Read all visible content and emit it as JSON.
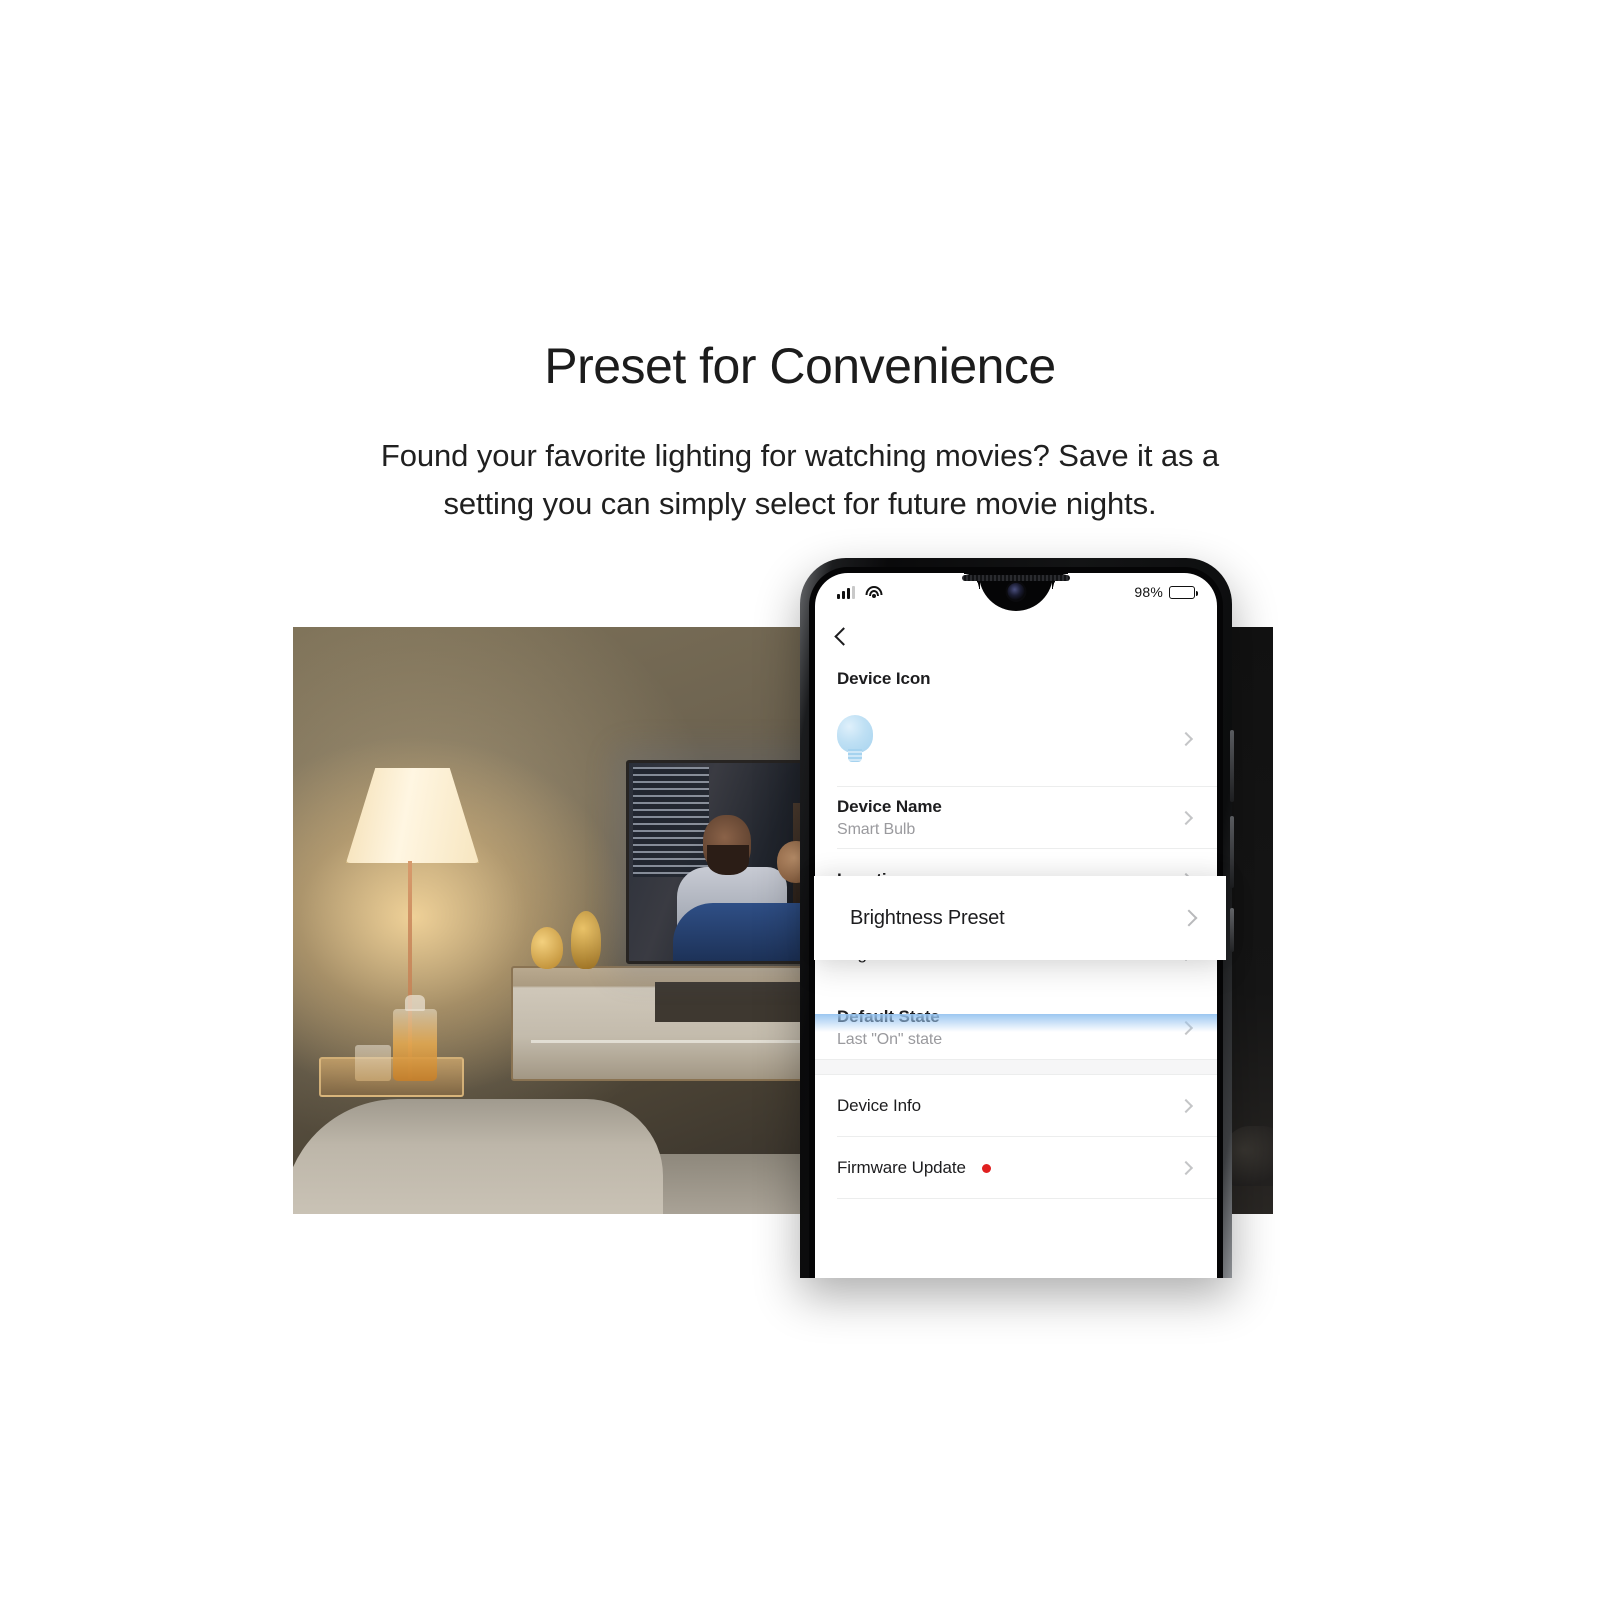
{
  "hero": {
    "title": "Preset for Convenience",
    "subtitle": "Found your favorite lighting for watching movies? Save it as a setting you can simply select for future movie nights."
  },
  "phone": {
    "status_bar": {
      "signal_icon": "cellular-signal-icon",
      "wifi_icon": "wifi-icon",
      "battery_percent": "98%",
      "battery_icon": "battery-full-icon"
    },
    "nav": {
      "back_icon": "back-chevron-icon"
    },
    "settings_list": [
      {
        "key": "device_icon",
        "title": "Device Icon",
        "subtitle": "",
        "icon": "light-bulb-icon",
        "chevron": "chevron-right-icon"
      },
      {
        "key": "device_name",
        "title": "Device Name",
        "subtitle": "Smart Bulb",
        "chevron": "chevron-right-icon"
      },
      {
        "key": "location",
        "title": "Location",
        "subtitle": "",
        "chevron": "chevron-right-icon"
      },
      {
        "key": "brightness_preset",
        "title": "Brightness Preset",
        "subtitle": "",
        "chevron": "chevron-right-icon"
      },
      {
        "key": "default_state",
        "title": "Default State",
        "subtitle": "Last \"On\" state",
        "chevron": "chevron-right-icon"
      },
      {
        "key": "device_info",
        "title": "Device Info",
        "subtitle": "",
        "chevron": "chevron-right-icon"
      },
      {
        "key": "firmware_update",
        "title": "Firmware Update",
        "subtitle": "",
        "badge": "update-available-dot",
        "chevron": "chevron-right-icon"
      }
    ],
    "highlight": {
      "title": "Brightness Preset",
      "chevron": "chevron-right-icon"
    }
  },
  "imagery": {
    "left_photo_alt": "warm-lit-living-room-with-floor-lamp-and-tv",
    "right_photo_alt": "dark-bedroom-photo-strip"
  },
  "colors": {
    "page_background": "#ffffff",
    "heading_text": "#1c1c1c",
    "body_text": "#202020",
    "row_title": "#1d1d1f",
    "row_subtitle": "#9a9a9e",
    "chevron": "#c4c5c7",
    "divider": "#eceded",
    "section_gap": "#f6f6f7",
    "highlight_glow": "#96c4f0",
    "badge_red": "#e02020",
    "bulb_blue": "#a6d3ef"
  }
}
